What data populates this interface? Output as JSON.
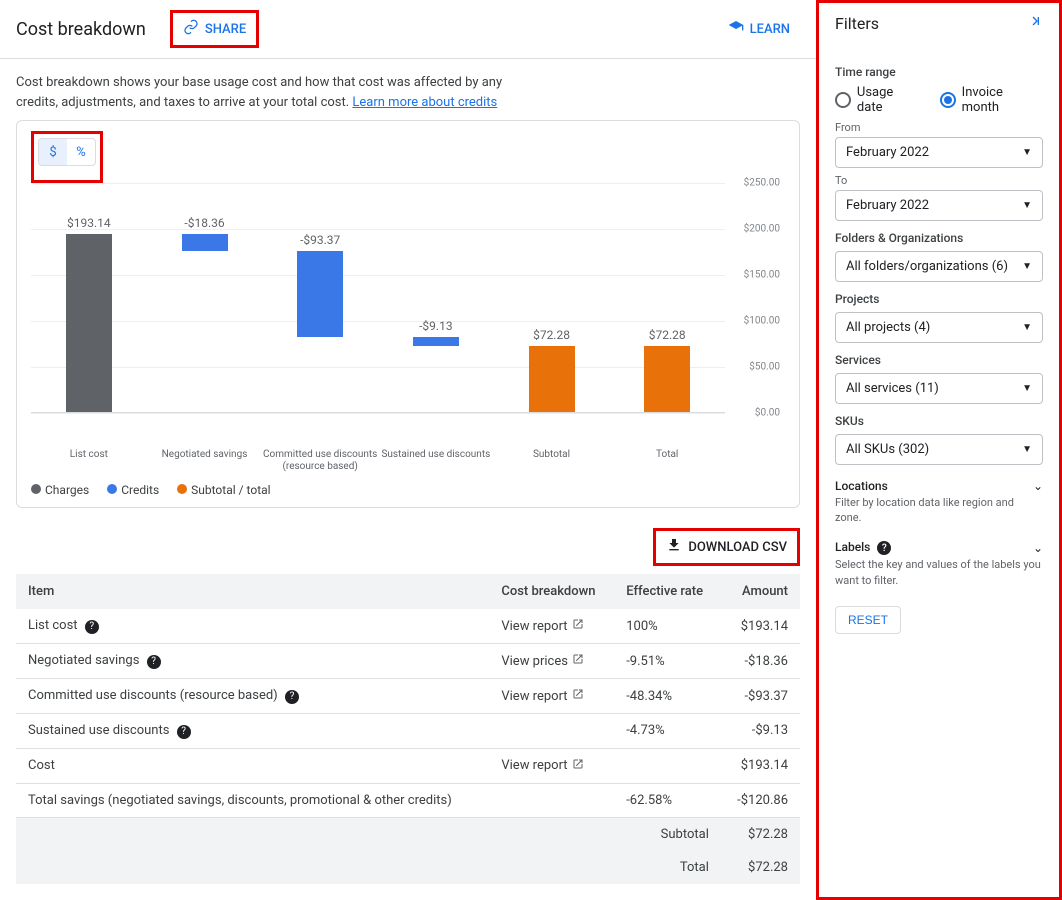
{
  "header": {
    "title": "Cost breakdown",
    "share_label": "SHARE",
    "learn_label": "LEARN"
  },
  "description": {
    "text": "Cost breakdown shows your base usage cost and how that cost was affected by any credits, adjustments, and taxes to arrive at your total cost. ",
    "link_text": "Learn more about credits"
  },
  "toggle": {
    "dollar": "$",
    "percent": "%"
  },
  "chart_data": {
    "type": "bar",
    "ylim": [
      0,
      250
    ],
    "ytick_labels": [
      "$0.00",
      "$50.00",
      "$100.00",
      "$150.00",
      "$200.00",
      "$250.00"
    ],
    "categories": [
      "List cost",
      "Negotiated savings",
      "Committed use discounts (resource based)",
      "Sustained use discounts",
      "Subtotal",
      "Total"
    ],
    "bars": [
      {
        "label": "$193.14",
        "value": 193.14,
        "bottom": 0,
        "color": "#5f6368"
      },
      {
        "label": "-$18.36",
        "value": 18.36,
        "bottom": 174.78,
        "color": "#3b78e7"
      },
      {
        "label": "-$93.37",
        "value": 93.37,
        "bottom": 81.41,
        "color": "#3b78e7"
      },
      {
        "label": "-$9.13",
        "value": 9.13,
        "bottom": 72.28,
        "color": "#3b78e7"
      },
      {
        "label": "$72.28",
        "value": 72.28,
        "bottom": 0,
        "color": "#e8710a"
      },
      {
        "label": "$72.28",
        "value": 72.28,
        "bottom": 0,
        "color": "#e8710a"
      }
    ],
    "legend": [
      {
        "label": "Charges",
        "color": "gray"
      },
      {
        "label": "Credits",
        "color": "blue"
      },
      {
        "label": "Subtotal / total",
        "color": "orange"
      }
    ]
  },
  "download_label": "DOWNLOAD CSV",
  "table": {
    "headers": {
      "item": "Item",
      "breakdown": "Cost breakdown",
      "rate": "Effective rate",
      "amount": "Amount"
    },
    "rows": [
      {
        "item": "List cost",
        "help": true,
        "breakdown": "View report",
        "ext": true,
        "rate": "100%",
        "amount": "$193.14"
      },
      {
        "item": "Negotiated savings",
        "help": true,
        "breakdown": "View prices",
        "ext": true,
        "rate": "-9.51%",
        "amount": "-$18.36"
      },
      {
        "item": "Committed use discounts (resource based)",
        "help": true,
        "breakdown": "View report",
        "ext": true,
        "rate": "-48.34%",
        "amount": "-$93.37"
      },
      {
        "item": "Sustained use discounts",
        "help": true,
        "breakdown": "",
        "ext": false,
        "rate": "-4.73%",
        "amount": "-$9.13"
      },
      {
        "item": "Cost",
        "help": false,
        "breakdown": "View report",
        "ext": true,
        "rate": "",
        "amount": "$193.14"
      },
      {
        "item": "Total savings (negotiated savings, discounts, promotional & other credits)",
        "help": false,
        "breakdown": "",
        "ext": false,
        "rate": "-62.58%",
        "amount": "-$120.86"
      }
    ],
    "summary": [
      {
        "label": "Subtotal",
        "amount": "$72.28"
      },
      {
        "label": "Total",
        "amount": "$72.28"
      }
    ]
  },
  "filters": {
    "title": "Filters",
    "time_range_label": "Time range",
    "radio1": "Usage date",
    "radio2": "Invoice month",
    "from_label": "From",
    "from_value": "February 2022",
    "to_label": "To",
    "to_value": "February 2022",
    "folders_label": "Folders & Organizations",
    "folders_value": "All folders/organizations (6)",
    "projects_label": "Projects",
    "projects_value": "All projects (4)",
    "services_label": "Services",
    "services_value": "All services (11)",
    "skus_label": "SKUs",
    "skus_value": "All SKUs (302)",
    "locations_label": "Locations",
    "locations_hint": "Filter by location data like region and zone.",
    "labels_label": "Labels",
    "labels_hint": "Select the key and values of the labels you want to filter.",
    "reset_label": "RESET"
  }
}
